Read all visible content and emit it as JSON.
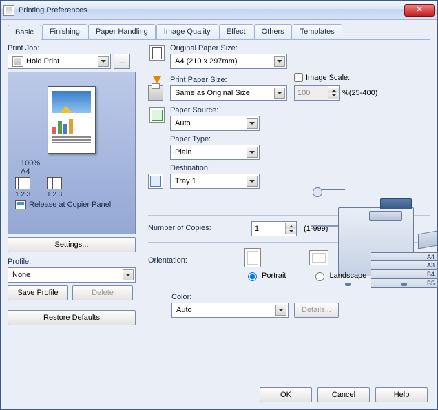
{
  "window": {
    "title": "Printing Preferences"
  },
  "tabs": [
    "Basic",
    "Finishing",
    "Paper Handling",
    "Image Quality",
    "Effect",
    "Others",
    "Templates"
  ],
  "active_tab": "Basic",
  "left": {
    "printjob_label": "Print Job:",
    "printjob_value": "Hold Print",
    "ellipsis": "...",
    "preview": {
      "zoom": "100%",
      "paper": "A4",
      "stack1": "1.2.3",
      "stack2": "1.2.3",
      "release": "Release at Copier Panel"
    },
    "settings_btn": "Settings...",
    "profile_label": "Profile:",
    "profile_value": "None",
    "save_profile": "Save Profile",
    "delete": "Delete",
    "restore": "Restore Defaults"
  },
  "right": {
    "orig_label": "Original Paper Size:",
    "orig_value": "A4 (210 x 297mm)",
    "print_label": "Print Paper Size:",
    "print_value": "Same as Original Size",
    "scale_label": "Image Scale:",
    "scale_value": "100",
    "scale_range": "%(25-400)",
    "src_label": "Paper Source:",
    "src_value": "Auto",
    "type_label": "Paper Type:",
    "type_value": "Plain",
    "dest_label": "Destination:",
    "dest_value": "Tray 1",
    "copies_label": "Number of Copies:",
    "copies_value": "1",
    "copies_range": "(1-999)",
    "orient_label": "Orientation:",
    "portrait": "Portrait",
    "landscape": "Landscape",
    "color_label": "Color:",
    "color_value": "Auto",
    "details": "Details...",
    "trays": [
      "A4",
      "A3",
      "B4",
      "B5"
    ]
  },
  "footer": {
    "ok": "OK",
    "cancel": "Cancel",
    "help": "Help"
  }
}
